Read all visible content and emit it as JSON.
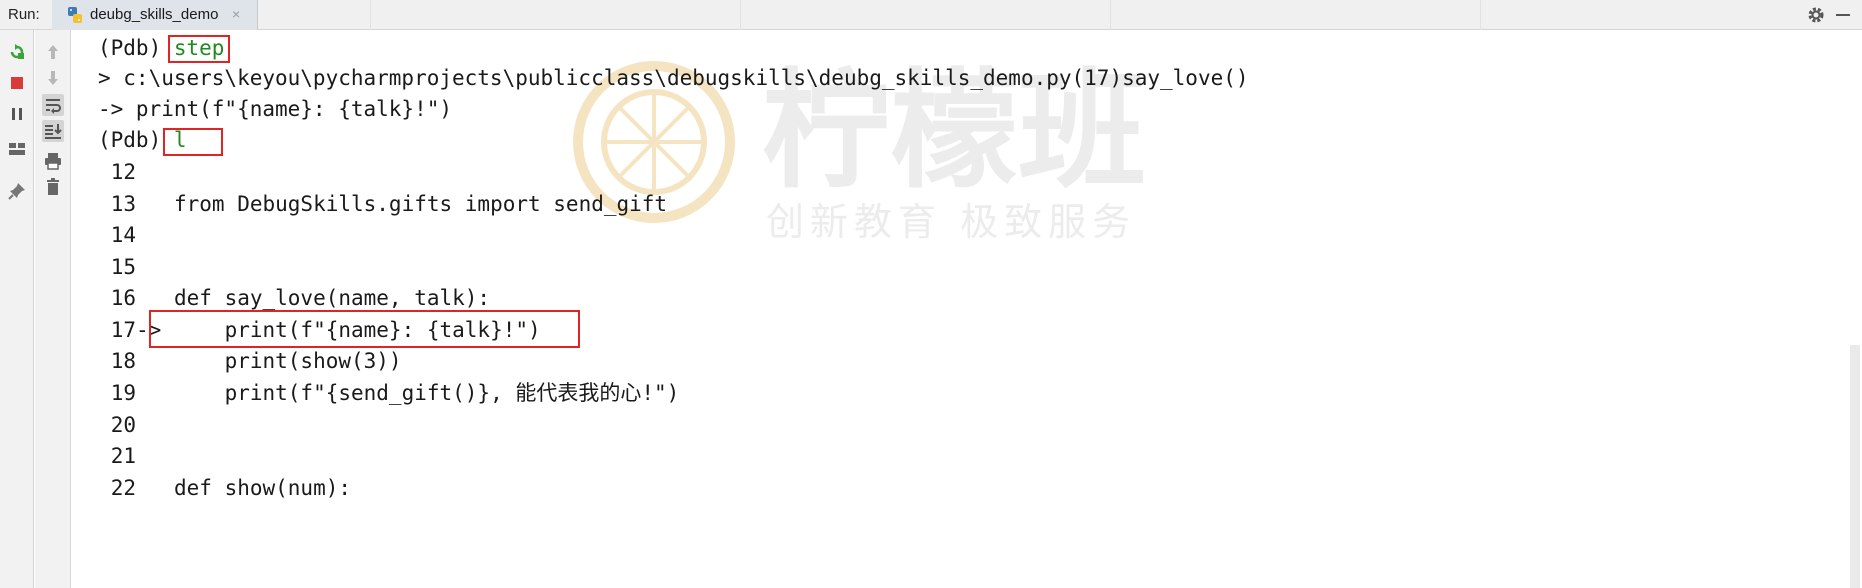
{
  "run_bar": {
    "label": "Run:",
    "tab_title": "deubg_skills_demo",
    "close_glyph": "×"
  },
  "console": {
    "lines": [
      {
        "prompt": "(Pdb) ",
        "cmd": "step"
      },
      {
        "text": "> c:\\users\\keyou\\pycharmprojects\\publicclass\\debugskills\\deubg_skills_demo.py(17)say_love()"
      },
      {
        "text": "-> print(f\"{name}: {talk}!\")"
      },
      {
        "prompt": "(Pdb) ",
        "cmd": "l"
      }
    ],
    "listing": [
      {
        "num": "12",
        "marker": "",
        "code": ""
      },
      {
        "num": "13",
        "marker": "",
        "code": "from DebugSkills.gifts import send_gift"
      },
      {
        "num": "14",
        "marker": "",
        "code": ""
      },
      {
        "num": "15",
        "marker": "",
        "code": ""
      },
      {
        "num": "16",
        "marker": "",
        "code": "def say_love(name, talk):"
      },
      {
        "num": "17",
        "marker": "->",
        "code": "    print(f\"{name}: {talk}!\")"
      },
      {
        "num": "18",
        "marker": "",
        "code": "    print(show(3))"
      },
      {
        "num": "19",
        "marker": "",
        "code": "    print(f\"{send_gift()}, 能代表我的心!\")"
      },
      {
        "num": "20",
        "marker": "",
        "code": ""
      },
      {
        "num": "21",
        "marker": "",
        "code": ""
      },
      {
        "num": "22",
        "marker": "",
        "code": "def show(num):"
      }
    ]
  },
  "watermark": {
    "title": "柠檬班",
    "subtitle": "创新教育  极致服务"
  },
  "icons": {
    "rerun": "rerun-icon",
    "stop": "stop-icon",
    "pause": "pause-icon",
    "layout": "layout-icon",
    "pin": "pin-icon",
    "up": "arrow-up-icon",
    "down": "arrow-down-icon",
    "soft_wrap": "soft-wrap-icon",
    "scroll_end": "scroll-to-end-icon",
    "print": "print-icon",
    "trash": "trash-icon",
    "settings": "gear-icon",
    "hide": "hide-icon"
  },
  "colors": {
    "highlight_box": "#e02424",
    "pdb_command": "#1f8a1f",
    "watermark": "#f0ddb8"
  }
}
